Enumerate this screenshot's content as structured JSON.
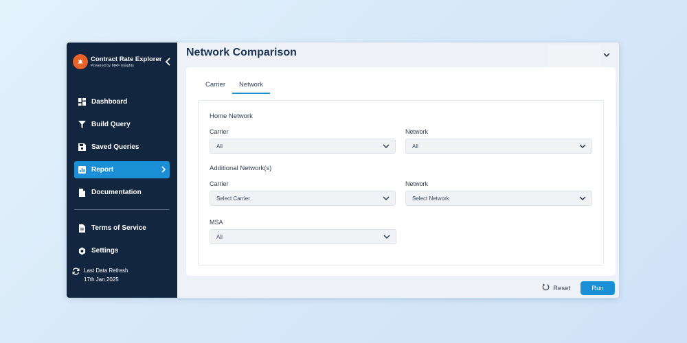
{
  "brand": {
    "title": "Contract Rate Explorer",
    "subtitle": "Powered by MRF Insights",
    "logo_icon": "deer-icon",
    "color": "#e8622a"
  },
  "sidebar": {
    "items": [
      {
        "label": "Dashboard",
        "icon": "dashboard-icon"
      },
      {
        "label": "Build Query",
        "icon": "funnel-icon"
      },
      {
        "label": "Saved Queries",
        "icon": "save-icon"
      },
      {
        "label": "Report",
        "icon": "chart-icon",
        "active": true
      },
      {
        "label": "Documentation",
        "icon": "document-icon"
      }
    ],
    "secondary": [
      {
        "label": "Terms of Service",
        "icon": "terms-icon"
      },
      {
        "label": "Settings",
        "icon": "gear-icon"
      }
    ],
    "refresh": {
      "label": "Last Data Refresh",
      "date": "17th Jan 2025"
    },
    "active_color": "#1a8fd6",
    "background": "#13263f"
  },
  "main": {
    "title": "Network Comparison",
    "tabs": [
      {
        "label": "Carrier"
      },
      {
        "label": "Network",
        "active": true
      }
    ],
    "home_network": {
      "label": "Home Network",
      "carrier_label": "Carrier",
      "carrier_value": "All",
      "network_label": "Network",
      "network_value": "All"
    },
    "additional": {
      "label": "Additional Network(s)",
      "carrier_label": "Carrier",
      "carrier_value": "Select Carrier",
      "network_label": "Network",
      "network_value": "Select Network"
    },
    "msa": {
      "label": "MSA",
      "value": "All"
    },
    "actions": {
      "reset": "Reset",
      "run": "Run"
    }
  }
}
